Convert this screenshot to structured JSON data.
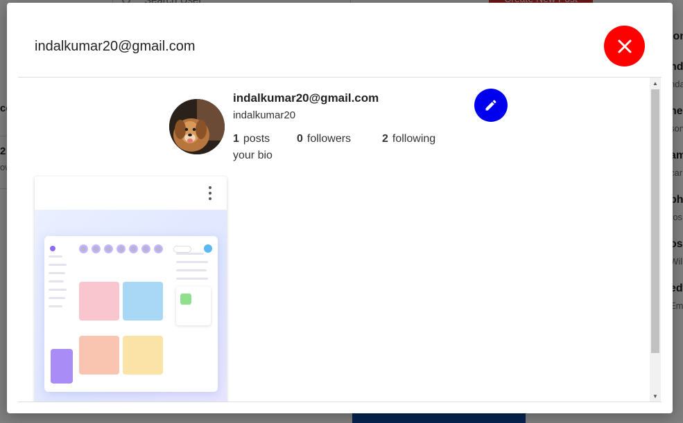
{
  "background": {
    "search_placeholder": "Search User",
    "create_button": "Create New Post",
    "left_fragments": [
      "co",
      "2",
      "ow"
    ],
    "right_fragments": [
      {
        "title": "ion",
        "sub": ""
      },
      {
        "title": "nd",
        "sub": "nda"
      },
      {
        "title": "hea",
        "sub": "son"
      },
      {
        "title": "am",
        "sub": "car"
      },
      {
        "title": "ph",
        "sub": "ros"
      },
      {
        "title": "osc",
        "sub": "Will"
      },
      {
        "title": "edw",
        "sub": "Emi"
      }
    ]
  },
  "modal": {
    "title": "indalkumar20@gmail.com",
    "close_icon": "close-icon",
    "edit_icon": "pencil-icon",
    "colors": {
      "close": "#ff0000",
      "edit": "#0000ee"
    }
  },
  "profile": {
    "email": "indalkumar20@gmail.com",
    "username": "indalkumar20",
    "posts_count": "1",
    "posts_label": "posts",
    "followers_count": "0",
    "followers_label": "followers",
    "following_count": "2",
    "following_label": "following",
    "bio": "your bio",
    "avatar": "dog-photo"
  },
  "posts": [
    {
      "menu_icon": "more-vertical-icon",
      "image": "social-app-dashboard-screenshot"
    }
  ]
}
